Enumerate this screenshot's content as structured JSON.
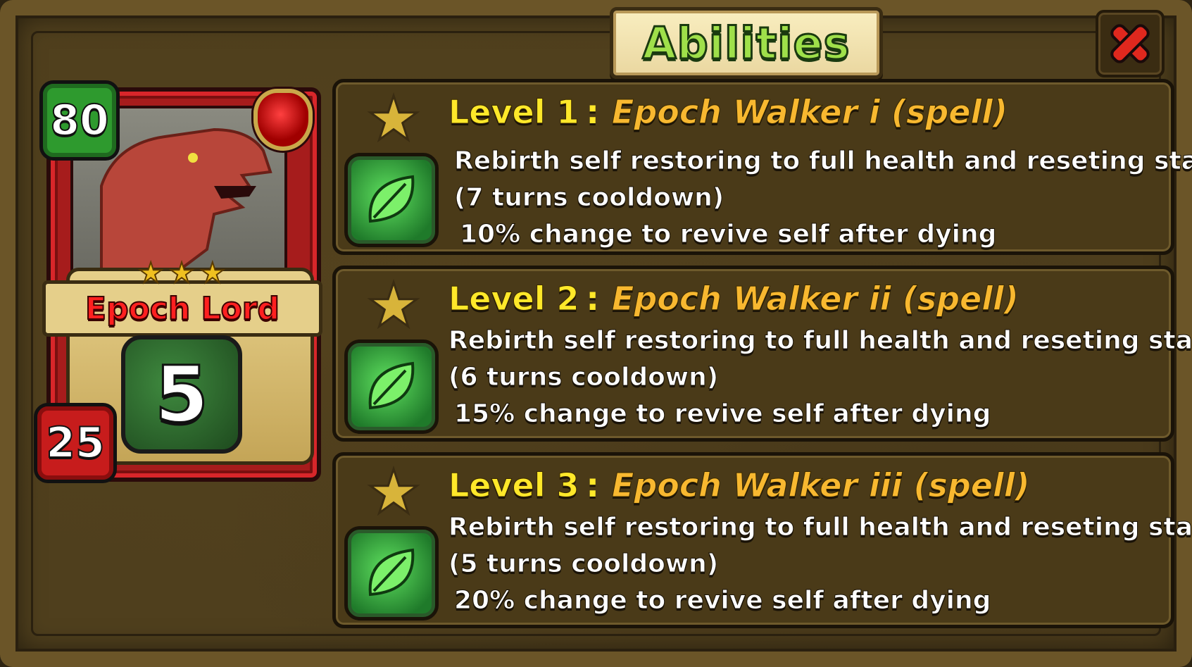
{
  "title": "Abilities",
  "close_icon": "close-x-icon",
  "card": {
    "name": "Epoch Lord",
    "health": "80",
    "attack": "25",
    "cost": "5",
    "stars": 3,
    "art": "dragon-head",
    "element_icon": "leaf-icon"
  },
  "abilities": [
    {
      "level": "Level 1",
      "name": "Epoch Walker i (spell)",
      "desc": "Rebirth self restoring to full health and reseting stats",
      "cooldown": "(7 turns cooldown)",
      "revive": "10% change to revive self after dying",
      "icon": "leaf-icon"
    },
    {
      "level": "Level 2",
      "name": "Epoch Walker ii (spell)",
      "desc": "Rebirth self restoring to full health and reseting stats",
      "cooldown": "(6 turns cooldown)",
      "revive": "15% change to revive self after dying",
      "icon": "leaf-icon"
    },
    {
      "level": "Level 3",
      "name": "Epoch Walker iii (spell)",
      "desc": "Rebirth self restoring to full health and reseting stats",
      "cooldown": "(5 turns cooldown)",
      "revive": "20% change to revive self after dying",
      "icon": "leaf-icon"
    }
  ],
  "colors": {
    "level_text": "#ffe82a",
    "ability_name": "#f8b830",
    "card_name": "#ff2020",
    "health_badge": "#2e9a2e",
    "attack_badge": "#c71c1c"
  }
}
